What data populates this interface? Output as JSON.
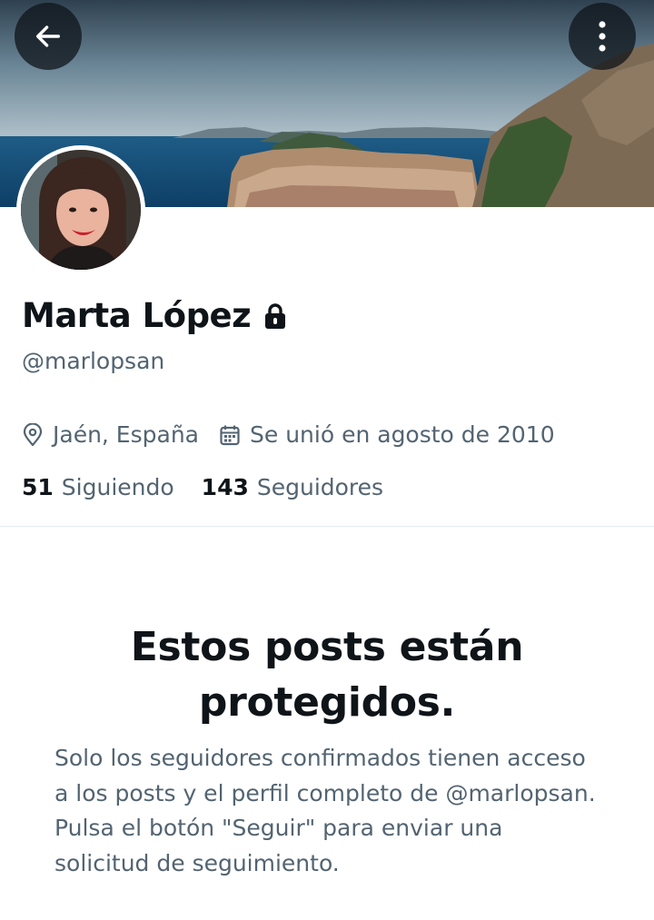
{
  "header": {
    "back_icon": "arrow-left-icon",
    "more_icon": "more-vertical-icon",
    "banner_image": "coastal-town-landscape"
  },
  "profile": {
    "avatar_image": "profile-photo-woman-smiling",
    "name": "Marta López",
    "protected_icon": "lock-icon",
    "handle": "@marlopsan",
    "location": "Jaén, España",
    "location_icon": "location-pin-icon",
    "joined": "Se unió en agosto de 2010",
    "joined_icon": "calendar-icon",
    "following_count": "51",
    "following_label": "Siguiendo",
    "followers_count": "143",
    "followers_label": "Seguidores"
  },
  "protected_notice": {
    "title": "Estos posts están protegidos.",
    "body": "Solo los seguidores confirmados tienen acceso a los posts y el perfil completo de @marlopsan. Pulsa el botón \"Seguir\" para enviar una solicitud de seguimiento."
  },
  "colors": {
    "text_primary": "#0f1419",
    "text_secondary": "#536471",
    "divider": "#e6ecf0",
    "overlay_button": "#0f1419"
  }
}
